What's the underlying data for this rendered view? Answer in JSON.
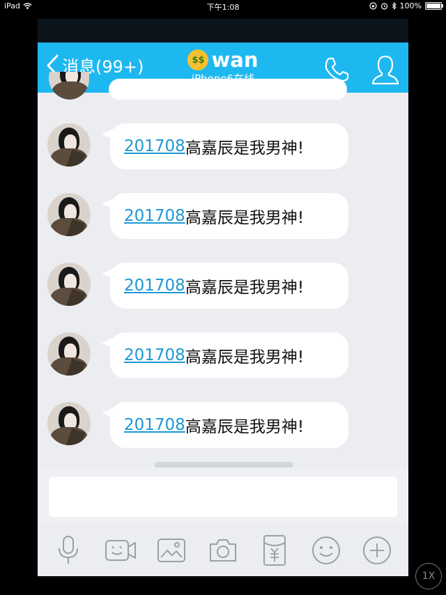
{
  "status_bar": {
    "device": "iPad",
    "time": "下午1:08",
    "battery": "100%",
    "battery_level": 1.0
  },
  "nav": {
    "back_label": "消息(99+)",
    "contact_name": "wan",
    "contact_status": "iPhone6在线",
    "emoji": "money-mouth-face"
  },
  "messages": [
    {
      "link": "201708",
      "text": "高嘉辰是我男神!"
    },
    {
      "link": "201708",
      "text": "高嘉辰是我男神!"
    },
    {
      "link": "201708",
      "text": "高嘉辰是我男神!"
    },
    {
      "link": "201708",
      "text": "高嘉辰是我男神!"
    },
    {
      "link": "201708",
      "text": "高嘉辰是我男神!"
    }
  ],
  "input": {
    "value": ""
  },
  "toolbar": {
    "icons": [
      "microphone-icon",
      "video-call-icon",
      "image-icon",
      "camera-icon",
      "red-packet-icon",
      "emoji-icon",
      "plus-icon"
    ]
  },
  "zoom_button": {
    "label": "1X"
  },
  "colors": {
    "nav": "#1eb8f1",
    "link": "#1d98d4",
    "chat_bg": "#ebedf0",
    "icon": "#9aa0a6"
  }
}
